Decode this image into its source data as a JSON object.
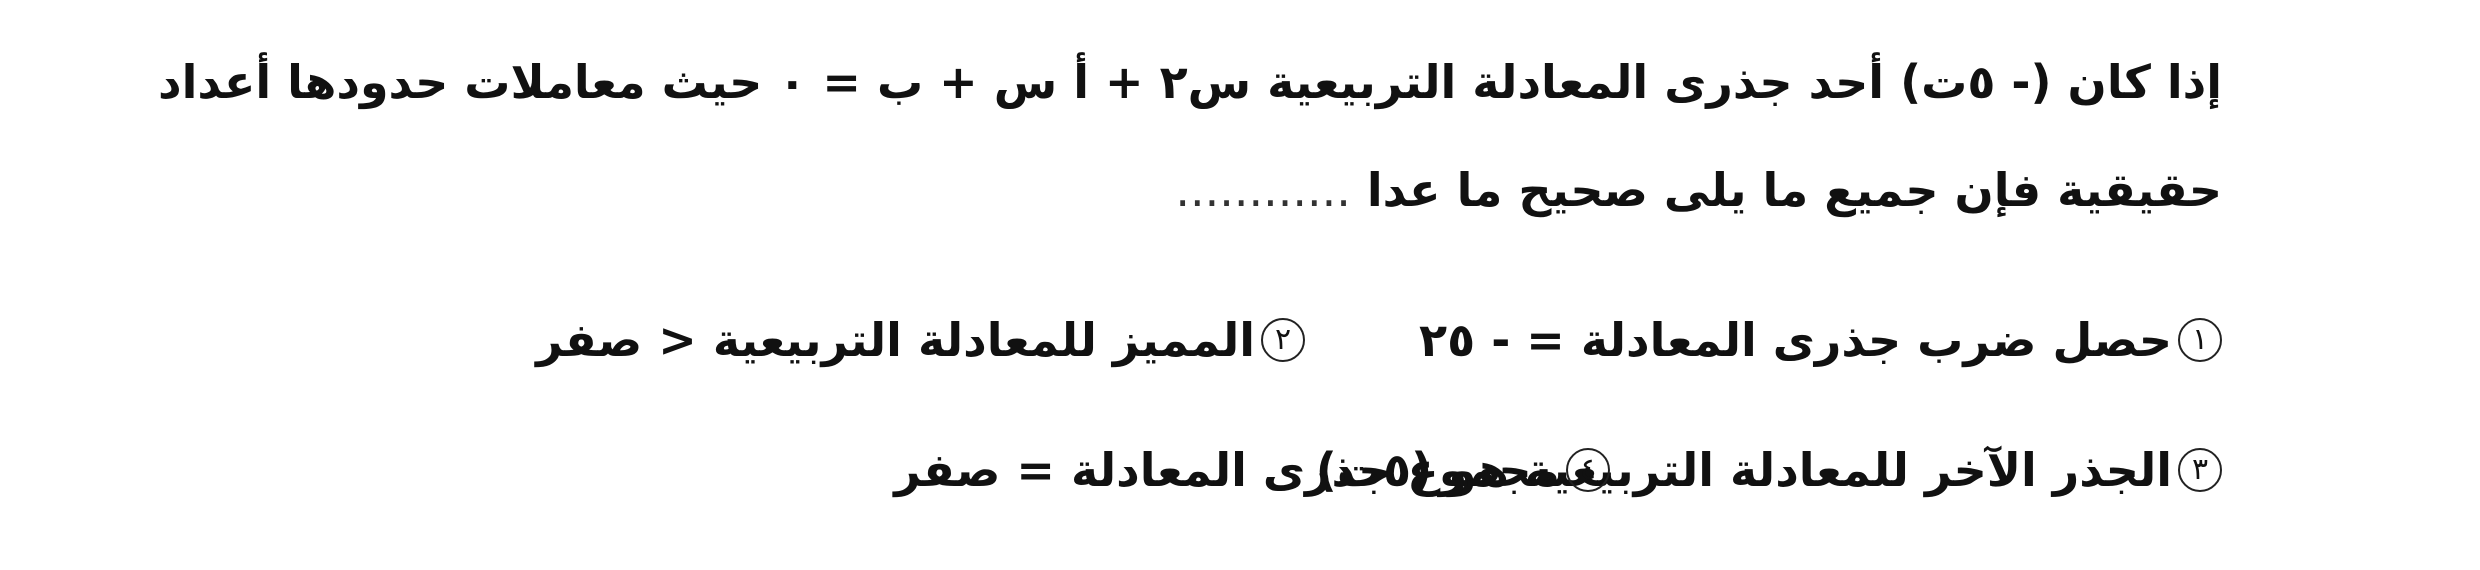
{
  "question": {
    "line1": "إذا كان (- ٥ت) أحد جذرى المعادلة التربيعية س٢ + أ س + ب = ٠ حيث معاملات حدودها أعداد",
    "line2": "حقيقية فإن جميع ما يلى صحيح ما عدا",
    "dots": "............"
  },
  "options": [
    {
      "number": "١",
      "text": "حصل ضرب جذرى المعادلة = - ٢٥"
    },
    {
      "number": "٢",
      "text": "المميز للمعادلة التربيعية < صفر"
    },
    {
      "number": "٣",
      "text": "الجذر الآخر للمعادلة التربيعية هو (٥ت)"
    },
    {
      "number": "٤",
      "text": "مجموع جذرى المعادلة = صفر"
    }
  ]
}
